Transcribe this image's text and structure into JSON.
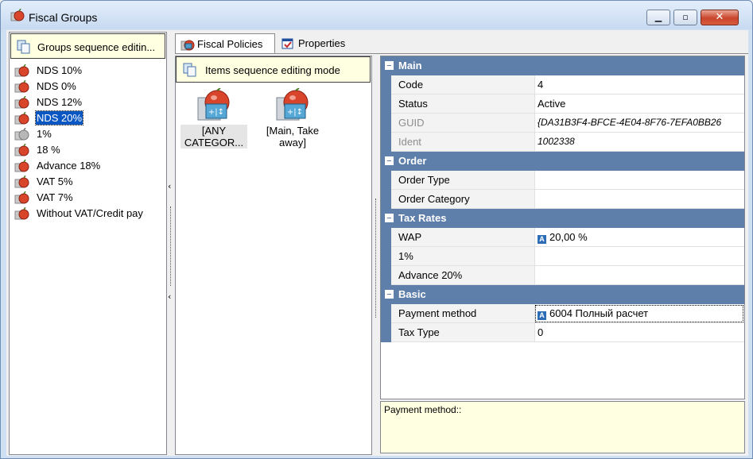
{
  "window": {
    "title": "Fiscal Groups"
  },
  "left": {
    "seq_button": "Groups sequence editin...",
    "groups": [
      {
        "label": "NDS 10%",
        "selected": false
      },
      {
        "label": "NDS 0%",
        "selected": false
      },
      {
        "label": "NDS 12%",
        "selected": false
      },
      {
        "label": "NDS 20%",
        "selected": true
      },
      {
        "label": "1%",
        "selected": false
      },
      {
        "label": "18 %",
        "selected": false
      },
      {
        "label": "Advance 18%",
        "selected": false
      },
      {
        "label": "VAT 5%",
        "selected": false
      },
      {
        "label": "VAT 7%",
        "selected": false
      },
      {
        "label": "Without VAT/Credit pay",
        "selected": false
      }
    ]
  },
  "tabs": [
    {
      "label": "Fiscal Policies"
    },
    {
      "label": "Properties"
    }
  ],
  "middle": {
    "seq_button": "Items sequence editing mode",
    "tiles": [
      {
        "label": "[ANY\nCATEGOR..."
      },
      {
        "label": "[Main, Take\naway]"
      }
    ]
  },
  "properties": {
    "main": {
      "title": "Main",
      "code_label": "Code",
      "code_value": "4",
      "status_label": "Status",
      "status_value": "Active",
      "guid_label": "GUID",
      "guid_value": "{DA31B3F4-BFCE-4E04-8F76-7EFA0BB26",
      "ident_label": "Ident",
      "ident_value": "1002338"
    },
    "order": {
      "title": "Order",
      "type_label": "Order Type",
      "category_label": "Order Category"
    },
    "tax": {
      "title": "Tax Rates",
      "wap_label": "WAP",
      "wap_value": "20,00 %",
      "one_label": "1%",
      "adv_label": "Advance 20%"
    },
    "basic": {
      "title": "Basic",
      "payment_label": "Payment method",
      "payment_value": "6004 Полный расчет",
      "taxtype_label": "Tax Type",
      "taxtype_value": "0"
    },
    "badge": "A"
  },
  "help": {
    "text": "Payment method::"
  },
  "colors": {
    "category_bar": "#5f7fab",
    "selection": "#0a57c4",
    "hint_bg": "#ffffe1"
  },
  "icons": {
    "app": "fiscal-apple-icon",
    "group": "apple-icon",
    "seq": "sequence-pages-icon",
    "properties": "properties-icon",
    "tile": "fiscal-policy-tile-icon"
  }
}
